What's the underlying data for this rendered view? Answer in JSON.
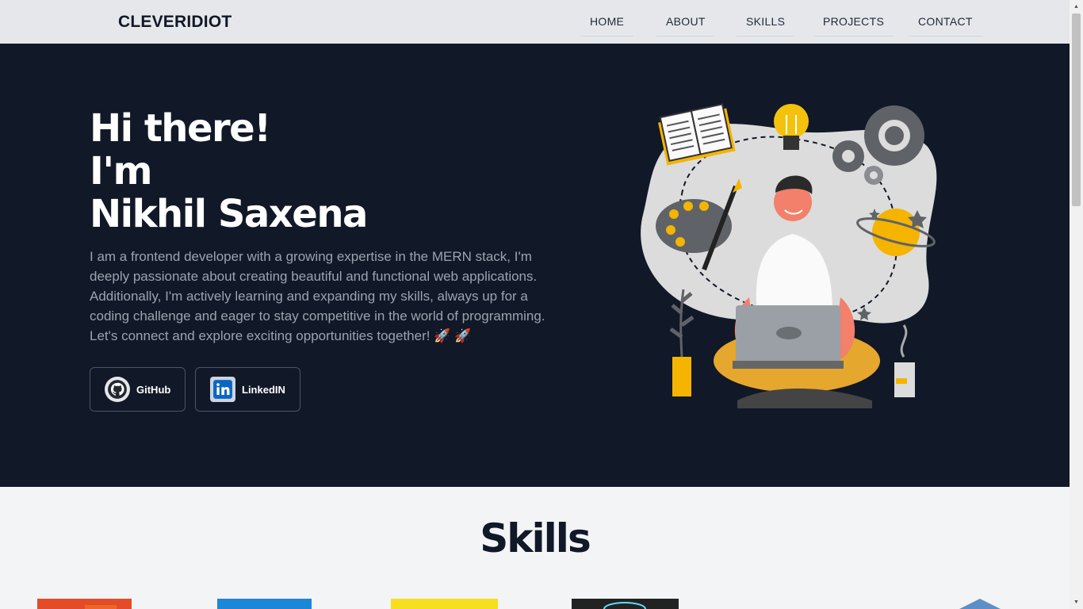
{
  "nav": {
    "logo": "CLEVERIDIOT",
    "items": [
      {
        "label": "HOME"
      },
      {
        "label": "ABOUT"
      },
      {
        "label": "SKILLS"
      },
      {
        "label": "PROJECTS"
      },
      {
        "label": "CONTACT"
      }
    ]
  },
  "hero": {
    "title_lines": [
      "Hi there!",
      "I'm",
      "Nikhil Saxena"
    ],
    "description": "I am a frontend developer with a growing expertise in the MERN stack, I'm deeply passionate about creating beautiful and functional web applications. Additionally, I'm actively learning and expanding my skills, always up for a coding challenge and eager to stay competitive in the world of programming. Let's connect and explore exciting opportunities together! 🚀 🚀",
    "buttons": [
      {
        "label": "GitHub",
        "icon": "github-icon"
      },
      {
        "label": "LinkedIN",
        "icon": "linkedin-icon"
      }
    ]
  },
  "skills": {
    "title": "Skills",
    "logos": [
      "html5-logo",
      "css3-logo",
      "javascript-logo",
      "react-logo",
      "nodejs-logo"
    ]
  },
  "colors": {
    "navbar_bg": "#e5e7eb",
    "hero_bg": "#111827",
    "page_bg": "#f3f4f6"
  }
}
